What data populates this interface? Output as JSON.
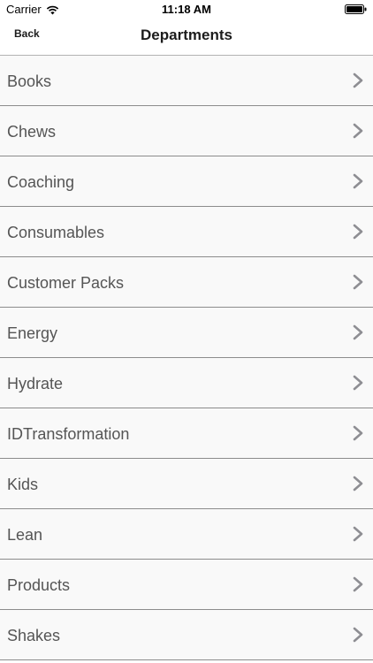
{
  "status": {
    "carrier": "Carrier",
    "time": "11:18 AM"
  },
  "nav": {
    "back_label": "Back",
    "title": "Departments"
  },
  "departments": [
    {
      "label": "Books"
    },
    {
      "label": "Chews"
    },
    {
      "label": "Coaching"
    },
    {
      "label": "Consumables"
    },
    {
      "label": "Customer Packs"
    },
    {
      "label": "Energy"
    },
    {
      "label": "Hydrate"
    },
    {
      "label": "IDTransformation"
    },
    {
      "label": "Kids"
    },
    {
      "label": "Lean"
    },
    {
      "label": "Products"
    },
    {
      "label": "Shakes"
    }
  ],
  "icons": {
    "wifi": "wifi-icon",
    "battery": "battery-icon",
    "chevron": "chevron-right-icon"
  },
  "colors": {
    "row_background": "#f9f9f9",
    "separator": "#8c8c8c",
    "label_text": "#555555",
    "chevron": "#8e8e93"
  }
}
